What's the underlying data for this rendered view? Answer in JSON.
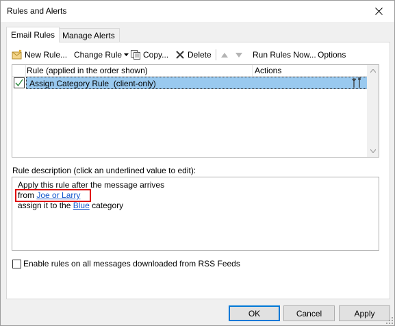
{
  "window": {
    "title": "Rules and Alerts"
  },
  "tabs": [
    {
      "label": "Email Rules",
      "active": true
    },
    {
      "label": "Manage Alerts",
      "active": false
    }
  ],
  "toolbar": {
    "new_rule": "New Rule...",
    "change_rule": "Change Rule",
    "copy": "Copy...",
    "delete": "Delete",
    "run_rules_now": "Run Rules Now...",
    "options": "Options"
  },
  "rules_table": {
    "headers": {
      "rule": "Rule (applied in the order shown)",
      "actions": "Actions"
    },
    "rows": [
      {
        "name": "Assign Category Rule  (client-only)",
        "enabled": true,
        "selected": true
      }
    ]
  },
  "description": {
    "label": "Rule description (click an underlined value to edit):",
    "line1": "Apply this rule after the message arrives",
    "line2_prefix": "from ",
    "line2_link": "Joe or Larry",
    "line3_prefix": "assign it to the ",
    "line3_link": "Blue",
    "line3_suffix": " category"
  },
  "rss_option": {
    "label": "Enable rules on all messages downloaded from RSS Feeds",
    "checked": false
  },
  "buttons": {
    "ok": "OK",
    "cancel": "Cancel",
    "apply": "Apply"
  },
  "colors": {
    "selected_row": "#99c9ef",
    "link": "#1155cc",
    "highlight_border": "#e00000",
    "default_button_border": "#0078d7"
  }
}
